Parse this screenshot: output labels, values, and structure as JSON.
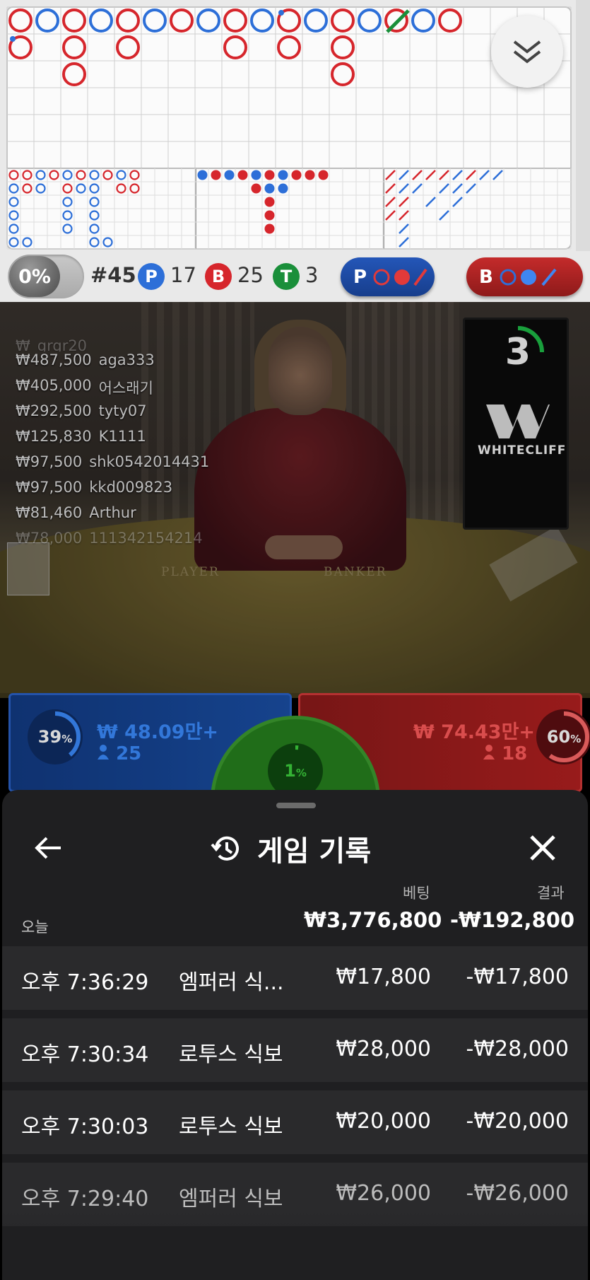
{
  "stats": {
    "percent": "0%",
    "round": "#45",
    "player_letter": "P",
    "player_count": "17",
    "banker_letter": "B",
    "banker_count": "25",
    "tie_letter": "T",
    "tie_count": "3",
    "player_predict_letter": "P",
    "banker_predict_letter": "B"
  },
  "colors": {
    "player": "#2d6fd8",
    "banker": "#d6262c",
    "tie": "#1a8f3a"
  },
  "big_road": [
    [
      "B",
      "P",
      "B",
      "P",
      "B",
      "P",
      "B",
      "P",
      "B",
      "P",
      "B",
      "P",
      "B",
      "P",
      "B",
      "P",
      "B"
    ],
    [
      "B",
      "",
      "B",
      "",
      "B",
      "",
      "",
      "",
      "B",
      "",
      "B",
      "",
      "B",
      "",
      "",
      "",
      ""
    ],
    [
      "",
      "",
      "B",
      "",
      "",
      "",
      "",
      "",
      "",
      "",
      "",
      "",
      "B",
      "",
      "",
      "",
      ""
    ]
  ],
  "timer": "3",
  "brand": "WHITECLIFF",
  "winners": [
    {
      "amount": "₩487,500",
      "user": "aga333"
    },
    {
      "amount": "₩405,000",
      "user": "어스래기"
    },
    {
      "amount": "₩292,500",
      "user": "tyty07"
    },
    {
      "amount": "₩125,830",
      "user": "K1111"
    },
    {
      "amount": "₩97,500",
      "user": "shk0542014431"
    },
    {
      "amount": "₩97,500",
      "user": "kkd009823"
    },
    {
      "amount": "₩81,460",
      "user": "Arthur"
    },
    {
      "amount": "₩78,000",
      "user": "111342154214"
    }
  ],
  "table": {
    "player_label": "PLAYER",
    "banker_label": "BANKER"
  },
  "bets": {
    "player": {
      "percent_num": "39",
      "percent_sign": "%",
      "amount": "₩ 48.09만+",
      "people": "25",
      "ratio": 0.39
    },
    "banker": {
      "percent_num": "60",
      "percent_sign": "%",
      "amount": "₩ 74.43만+",
      "people": "18",
      "ratio": 0.6
    },
    "tie": {
      "percent_num": "1",
      "percent_sign": "%",
      "ratio": 0.01
    }
  },
  "sheet": {
    "title": "게임 기록",
    "col_bet": "베팅",
    "col_result": "결과",
    "today_label": "오늘",
    "today_bet": "₩3,776,800",
    "today_result": "-₩192,800",
    "rows": [
      {
        "time": "오후 7:36:29",
        "game": "엠퍼러 식...",
        "bet": "₩17,800",
        "result": "-₩17,800"
      },
      {
        "time": "오후 7:30:34",
        "game": "로투스 식보",
        "bet": "₩28,000",
        "result": "-₩28,000"
      },
      {
        "time": "오후 7:30:03",
        "game": "로투스 식보",
        "bet": "₩20,000",
        "result": "-₩20,000"
      },
      {
        "time": "오후 7:29:40",
        "game": "엠퍼러 식보",
        "bet": "₩26,000",
        "result": "-₩26,000"
      }
    ]
  }
}
